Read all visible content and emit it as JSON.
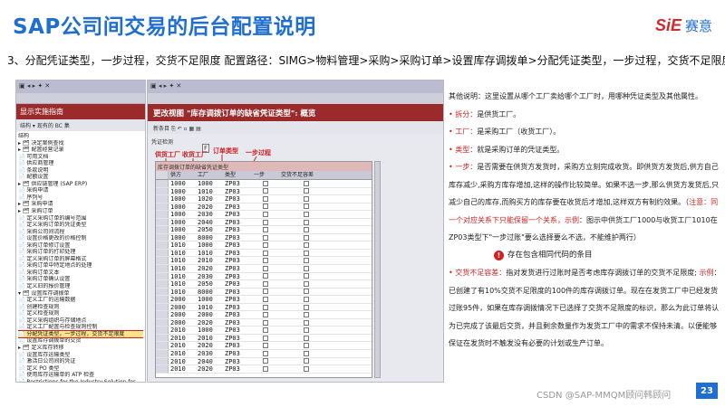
{
  "slide": {
    "title": "SAP公司间交易的后台配置说明",
    "logo_mark": "SiE",
    "logo_text": "赛意",
    "subtitle": "3、分配凭证类型，一步过程，交货不足限度   配置路径：SIMG>物料管理>采购>采购订单>设置库存调拨单>分配凭证类型，一步过程，交货不足限度；",
    "page_number": "23",
    "watermark": "CSDN @SAP-MMQM顾问韩顾问"
  },
  "left_panel": {
    "window_title": "显示实施指南",
    "toolbar": "结构 ▾ 现有的 BC 集",
    "tree_header": "结构",
    "tree": [
      "▸ 🗂 决定案例查找",
      "  ▸ 🗂 配置经营记录",
      "     📄 可用文档",
      "     📄 供应商管理",
      "     📄 条款说明",
      "     📄 配额设置",
      "  ▸ 🗂 供应链管理 (SAP ERP)",
      "     📄 采购申请",
      "     📄 序列号",
      "  ▸ 🗂 采购申请",
      "  ▸ 🗂 采购订单",
      "     📄 定义采购订单的编号范围",
      "     📄 定义采购订单的凭证类型",
      "     📄 采购公司间流程",
      "     📄 设置价格更改的价格控制",
      "     📄 采购订单修订设置",
      "     📄 采购订单的打印处理",
      "     📄 定义采购订单的屏幕格式",
      "     📄 采购订单中特定地点的处理",
      "     📄 采购订单文本",
      "     📄 采购订单确认设置",
      "     📄 定义旧的报价管理",
      "  ▾ 🗂 设置库存调拨单",
      "     📄 定义工厂的运输数据",
      "     📄 创建检查规则",
      "     📄 定义检查规则",
      "     📄 定义采购组织与存储地点",
      "     📄 定义工厂配置与检查规则控制",
      "     📄 分配凭证类型，一步过程，交货不足限度",
      "     📄 设置库存调拨单的交货",
      "  ▸ 🗂 定义库存转移",
      "     📄 设置库存运输类型",
      "     📄 激活日公司间的凭证",
      "     📄 定义 PO 类型",
      "     📄 使用库存运输单的 ATP 检查",
      "     📄 Restrictions for the Industry Solution for",
      "  ▸ 🗂 采购订单计划",
      "  ▸ 🗂 设置附件与公司",
      "  ▸ 🗂 库存调拨单"
    ]
  },
  "right_panel": {
    "window_title": "更改视图 \"库存调拨订单的缺省凭证类型\": 概览",
    "toolbar": "新条目  ⎘  ↶  ▫  ▦  ▤",
    "view_label": "凭证检测",
    "f_button": "F",
    "annotations": [
      "供货工厂",
      "收货工厂",
      "订单类型",
      "一步过程"
    ],
    "section_header": "库存调拨订单的缺省凭证类型",
    "columns": [
      "供方",
      "工厂",
      "类型",
      "一步",
      "交货不足容差"
    ],
    "rows": [
      [
        "1000",
        "1000",
        "ZP03"
      ],
      [
        "1000",
        "1010",
        "ZP03"
      ],
      [
        "1000",
        "1020",
        "ZP03"
      ],
      [
        "1000",
        "2020",
        "ZP03"
      ],
      [
        "1000",
        "2030",
        "ZP03"
      ],
      [
        "1000",
        "2040",
        "ZP03"
      ],
      [
        "1000",
        "2050",
        "ZP03"
      ],
      [
        "1000",
        "8000",
        "ZP03"
      ],
      [
        "1010",
        "1000",
        "ZP03"
      ],
      [
        "1010",
        "1010",
        "ZP03"
      ],
      [
        "1010",
        "2010",
        "ZP03"
      ],
      [
        "1010",
        "2020",
        "ZP03"
      ],
      [
        "1010",
        "2030",
        "ZP03"
      ],
      [
        "1010",
        "2050",
        "ZP03"
      ],
      [
        "1010",
        "8000",
        "ZP03"
      ],
      [
        "2000",
        "1000",
        "ZP03"
      ],
      [
        "2000",
        "1010",
        "ZP03"
      ],
      [
        "2000",
        "2000",
        "ZP03"
      ],
      [
        "2000",
        "2020",
        "ZP03"
      ],
      [
        "2010",
        "1000",
        "ZP03"
      ],
      [
        "2010",
        "2010",
        "ZP03"
      ],
      [
        "2010",
        "2020",
        "ZP03"
      ],
      [
        "2010",
        "2030",
        "ZP03"
      ],
      [
        "2010",
        "2040",
        "ZP03"
      ],
      [
        "2010",
        "2020",
        "ZP03"
      ]
    ]
  },
  "explanation": {
    "intro": "其他说明：这里设置从哪个工厂卖给哪个工厂时，用哪种凭证类型及其他属性。",
    "items": [
      {
        "term": "拆分",
        "text": "是供货工厂。"
      },
      {
        "term": "工厂",
        "text": "是采购工厂（收货工厂）。"
      },
      {
        "term": "类型",
        "text": "就是采购订单的凭证类型。"
      }
    ],
    "step_term": "一步",
    "step_text": "是否需要在供货方发货时，采购方立刻完成收货。即供货方发货后,供方自己库存减少,采购方库存增加,这样的操作比较简单。如果不选一步,那么供货方发货后,只减少自己的库存,而购买方的库存要在收货后才增加,这样双方有制约效果。（",
    "note_label": "注意",
    "note_text": "：同一个对应关系下只能保留一个关系，",
    "example_label": "示例",
    "example_text": "：图示中供货工厂1000与收货工厂1010在ZP03类型下\"一步过账\"要么选择要么不选，不能维护两行）",
    "error_text": "存在包含相同代码的条目",
    "tolerance_term": "交货不足容差",
    "tolerance_text": "指对发货进行过账时是否考虑库存调拨订单的交货不足限度;",
    "example2_label": "示例",
    "example2_text": "：已创建了有10%交货不足限度的100件的库存调拨订单。现在在发货工厂中已经发货过账95件，如果在库存调拨情况下已选择了交货不足限度的标识，那么为此订单将认为已完成了该最后交货，并且剩余数量作为发货工厂中的需求不保持未清。以便能够保证在发货时不触发没有必要的计划或生产订单。"
  }
}
